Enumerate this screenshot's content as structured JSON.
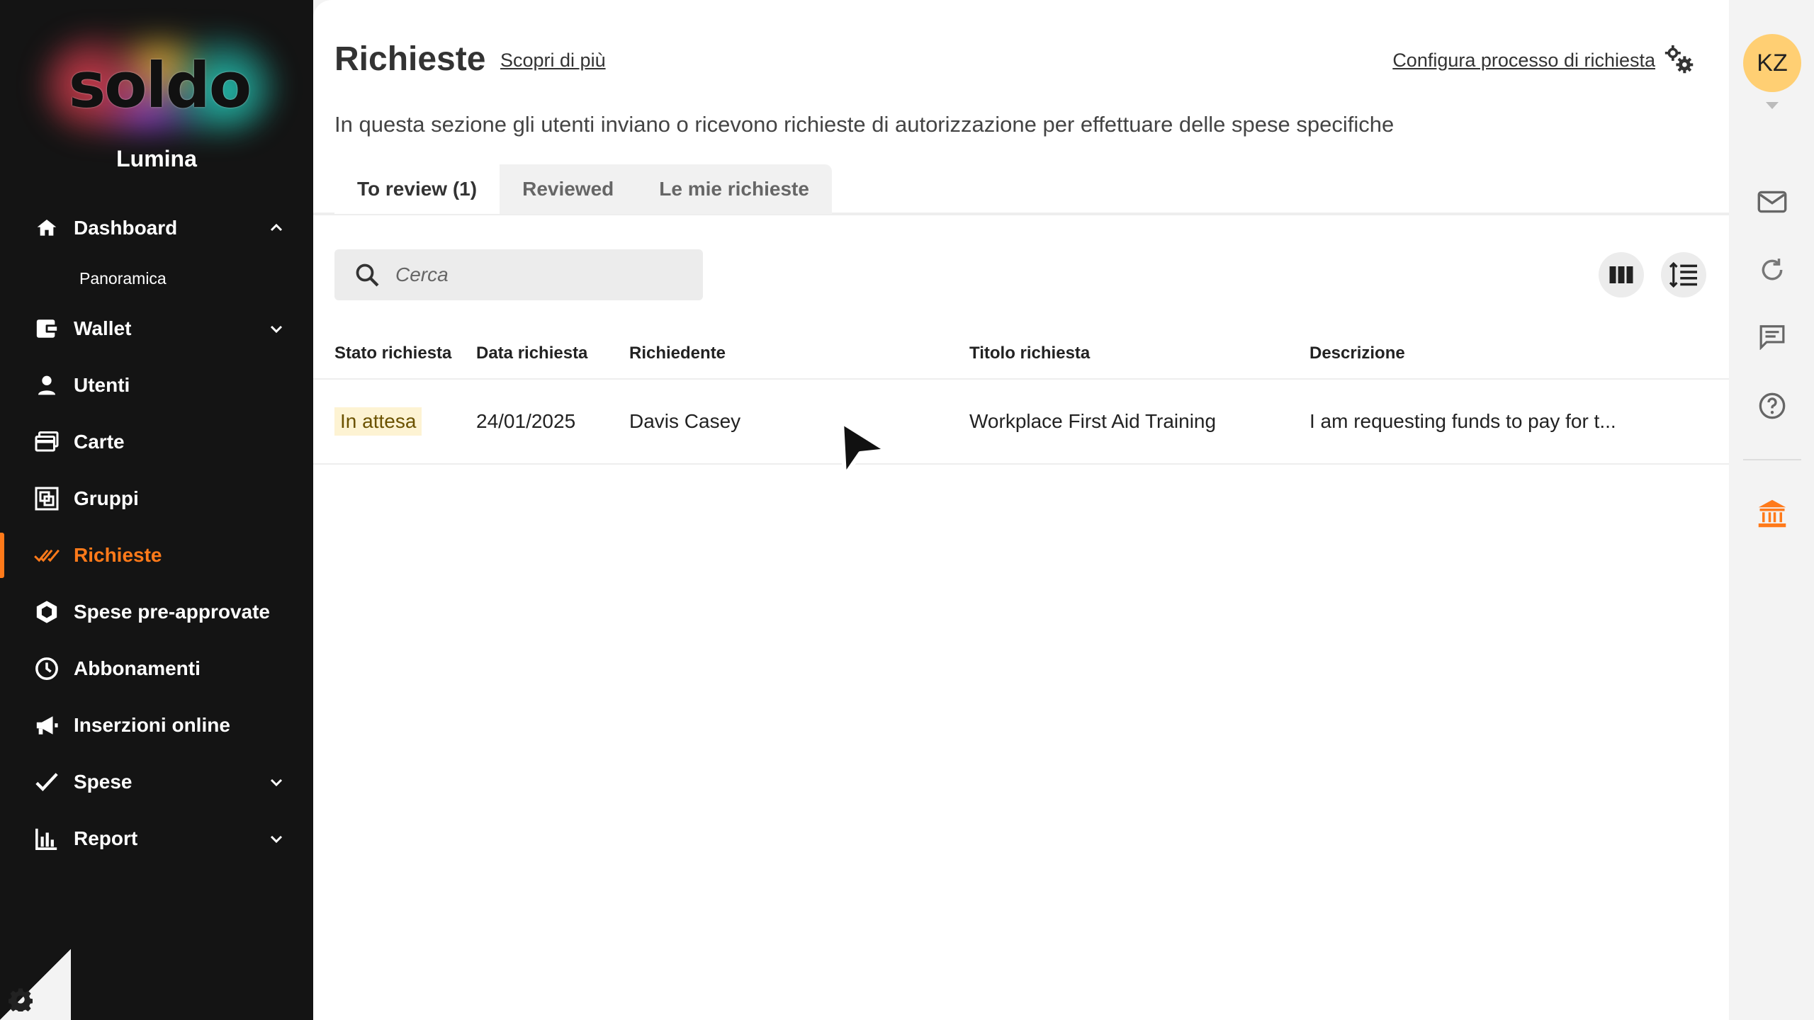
{
  "sidebar": {
    "logo": "soldo",
    "company": "Lumina",
    "items": [
      {
        "label": "Dashboard",
        "icon": "home-icon",
        "expanded": true
      },
      {
        "label": "Panoramica",
        "sub": true
      },
      {
        "label": "Wallet",
        "icon": "wallet-icon",
        "collapsible": true
      },
      {
        "label": "Utenti",
        "icon": "user-icon"
      },
      {
        "label": "Carte",
        "icon": "cards-icon"
      },
      {
        "label": "Gruppi",
        "icon": "groups-icon"
      },
      {
        "label": "Richieste",
        "icon": "double-check-icon",
        "active": true
      },
      {
        "label": "Spese pre-approvate",
        "icon": "hexagon-icon"
      },
      {
        "label": "Abbonamenti",
        "icon": "clock-icon"
      },
      {
        "label": "Inserzioni online",
        "icon": "megaphone-icon"
      },
      {
        "label": "Spese",
        "icon": "check-icon",
        "collapsible": true
      },
      {
        "label": "Report",
        "icon": "bar-chart-icon",
        "collapsible": true
      }
    ],
    "accent_color": "#ff7a1a"
  },
  "header": {
    "title": "Richieste",
    "learn_more": "Scopri di più",
    "configure": "Configura processo di richiesta",
    "description": "In questa sezione gli utenti inviano o ricevono richieste di autorizzazione per effettuare delle spese specifiche"
  },
  "tabs": [
    {
      "label": "To review (1)",
      "active": true
    },
    {
      "label": "Reviewed"
    },
    {
      "label": "Le mie richieste"
    }
  ],
  "search": {
    "placeholder": "Cerca"
  },
  "table": {
    "columns": [
      "Stato richiesta",
      "Data richiesta",
      "Richiedente",
      "Titolo richiesta",
      "Descrizione"
    ],
    "rows": [
      {
        "status": "In attesa",
        "date": "24/01/2025",
        "requester": "Davis Casey",
        "title": "Workplace First Aid Training",
        "description": "I am requesting funds to pay for t..."
      }
    ]
  },
  "user": {
    "initials": "KZ",
    "avatar_color": "#ffcf73"
  },
  "rail_icons": [
    "mail-icon",
    "refresh-icon",
    "chat-icon",
    "help-icon",
    "bank-icon"
  ]
}
